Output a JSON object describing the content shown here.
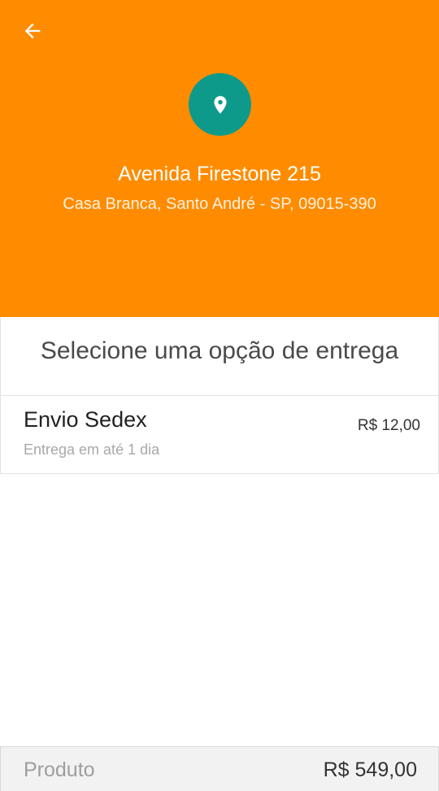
{
  "header": {
    "background_color": "#FF8C00",
    "back_icon": "arrow-left-icon",
    "pin_icon": "map-pin-icon",
    "pin_circle_color": "#0E9A8A",
    "address_line1": "Avenida Firestone 215",
    "address_line2": "Casa Branca, Santo André - SP, 09015-390"
  },
  "delivery": {
    "title": "Selecione uma opção de entrega",
    "options": [
      {
        "name": "Envio Sedex",
        "description": "Entrega em até 1 dia",
        "price": "R$ 12,00"
      }
    ]
  },
  "footer": {
    "label": "Produto",
    "price": "R$ 549,00"
  }
}
